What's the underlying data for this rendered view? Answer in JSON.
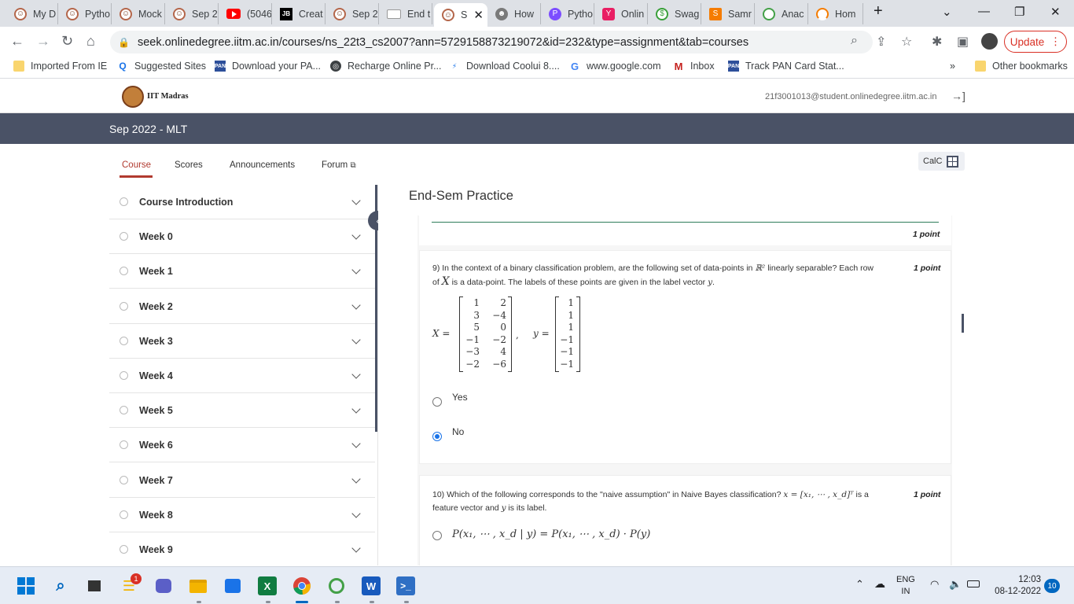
{
  "browser": {
    "tabs": [
      {
        "label": "My D",
        "icon": "seek-icon"
      },
      {
        "label": "Pytho",
        "icon": "seek-icon"
      },
      {
        "label": "Mock",
        "icon": "seek-icon"
      },
      {
        "label": "Sep 2",
        "icon": "seek-icon"
      },
      {
        "label": "(5046",
        "icon": "youtube-icon"
      },
      {
        "label": "Creat",
        "icon": "jetbrains-icon"
      },
      {
        "label": "Sep 2",
        "icon": "seek-icon"
      },
      {
        "label": "End t",
        "icon": "page-icon"
      },
      {
        "label": "S",
        "icon": "seek-icon",
        "active": true
      },
      {
        "label": "How",
        "icon": "person-icon"
      },
      {
        "label": "Pytho",
        "icon": "python-icon"
      },
      {
        "label": "Onlin",
        "icon": "online-icon"
      },
      {
        "label": "Swag",
        "icon": "swag-icon"
      },
      {
        "label": "Samr",
        "icon": "samr-icon"
      },
      {
        "label": "Anac",
        "icon": "anaconda-icon"
      },
      {
        "label": "Hom",
        "icon": "home-icon"
      }
    ],
    "url": "seek.onlinedegree.iitm.ac.in/courses/ns_22t3_cs2007?ann=5729158873219072&id=232&type=assignment&tab=courses",
    "update_label": "Update",
    "bookmarks": [
      {
        "label": "Imported From IE",
        "icon": "folder"
      },
      {
        "label": "Suggested Sites",
        "icon": "search"
      },
      {
        "label": "Download your PA...",
        "icon": "pan"
      },
      {
        "label": "Recharge Online Pr...",
        "icon": "globe"
      },
      {
        "label": "Download Coolui 8....",
        "icon": "bolt"
      },
      {
        "label": "www.google.com",
        "icon": "g"
      },
      {
        "label": "Inbox",
        "icon": "m"
      },
      {
        "label": "Track PAN Card Stat...",
        "icon": "pan"
      }
    ],
    "more_bookmarks": "»",
    "other_bookmarks": "Other bookmarks"
  },
  "site": {
    "logo_text": "IIT Madras",
    "email": "21f3001013@student.onlinedegree.iitm.ac.in",
    "course_title": "Sep 2022 - MLT",
    "nav_tabs": [
      "Course",
      "Scores",
      "Announcements",
      "Forum"
    ],
    "calc_label": "CalC"
  },
  "sidebar": {
    "items": [
      "Course Introduction",
      "Week 0",
      "Week 1",
      "Week 2",
      "Week 3",
      "Week 4",
      "Week 5",
      "Week 6",
      "Week 7",
      "Week 8",
      "Week 9"
    ]
  },
  "main": {
    "assignment_title": "End-Sem Practice",
    "prev_points": "1 point",
    "q9": {
      "number": "9)",
      "text_a": "In the context of a binary classification problem, are the following set of data-points in",
      "text_b": "linearly separable? Each row",
      "text_c": "of",
      "text_d": "is a data-point. The labels of these points are given in the label vector",
      "points": "1 point",
      "matrix_X": [
        [
          "1",
          "2"
        ],
        [
          "3",
          "−4"
        ],
        [
          "5",
          "0"
        ],
        [
          "−1",
          "−2"
        ],
        [
          "−3",
          "4"
        ],
        [
          "−2",
          "−6"
        ]
      ],
      "vector_y": [
        "1",
        "1",
        "1",
        "−1",
        "−1",
        "−1"
      ],
      "options": [
        {
          "label": "Yes",
          "checked": false
        },
        {
          "label": "No",
          "checked": true
        }
      ]
    },
    "q10": {
      "number": "10)",
      "text_a": "Which of the following corresponds to the \"naive assumption\" in Naive Bayes classification?",
      "math_a": "x = [x₁, ⋯ , x_d]ᵀ",
      "text_b": "is a",
      "text_c": "feature vector and",
      "text_d": "is its label.",
      "points": "1 point",
      "option1": "P(x₁, ⋯ , x_d | y) = P(x₁, ⋯ , x_d) · P(y)"
    }
  },
  "taskbar": {
    "lang_top": "ENG",
    "lang_bottom": "IN",
    "time": "12:03",
    "date": "08-12-2022",
    "notifications": "10",
    "badge": "1"
  }
}
